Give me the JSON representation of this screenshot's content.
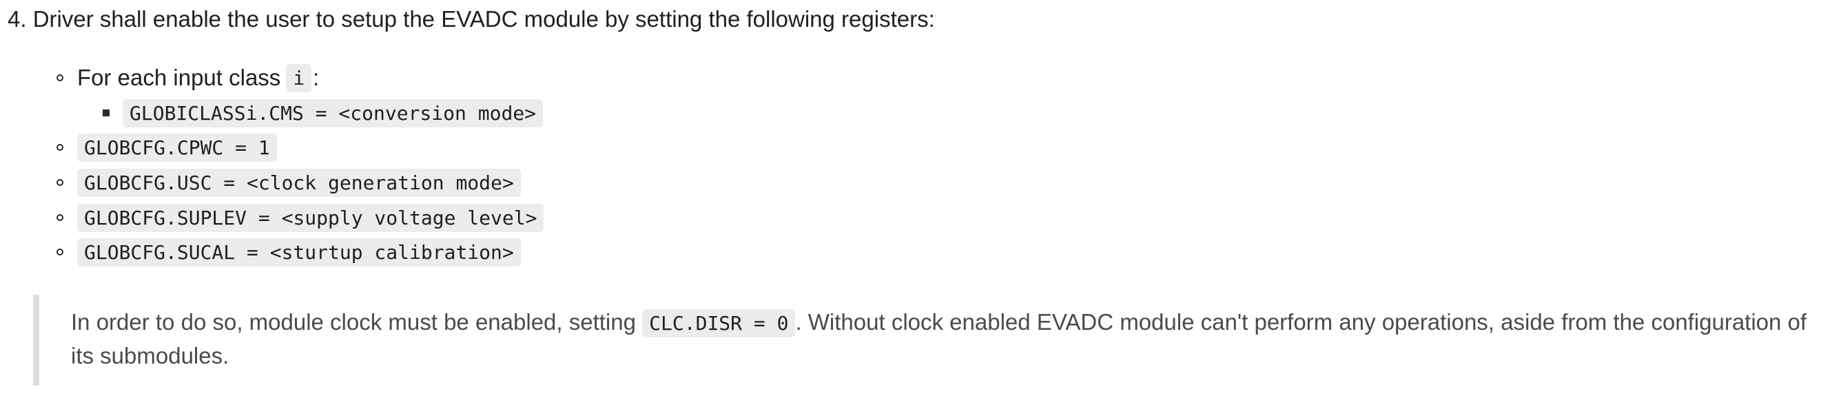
{
  "step": {
    "number": "4.",
    "text": "Driver shall enable the user to setup the EVADC module by setting the following registers:"
  },
  "items": [
    {
      "type": "text-with-code",
      "prefix": "For each input class ",
      "code": "i",
      "suffix": ":"
    },
    {
      "type": "code",
      "code": "GLOBCFG.CPWC = 1"
    },
    {
      "type": "code",
      "code": "GLOBCFG.USC = <clock generation mode>"
    },
    {
      "type": "code",
      "code": "GLOBCFG.SUPLEV = <supply voltage level>"
    },
    {
      "type": "code",
      "code": "GLOBCFG.SUCAL = <sturtup calibration>"
    }
  ],
  "subitems": [
    {
      "code": "GLOBICLASSi.CMS = <conversion mode>"
    }
  ],
  "note": {
    "before": "In order to do so, module clock must be enabled, setting ",
    "code": "CLC.DISR = 0",
    "after": ". Without clock enabled EVADC module can't perform any operations, aside from the configuration of its submodules."
  }
}
